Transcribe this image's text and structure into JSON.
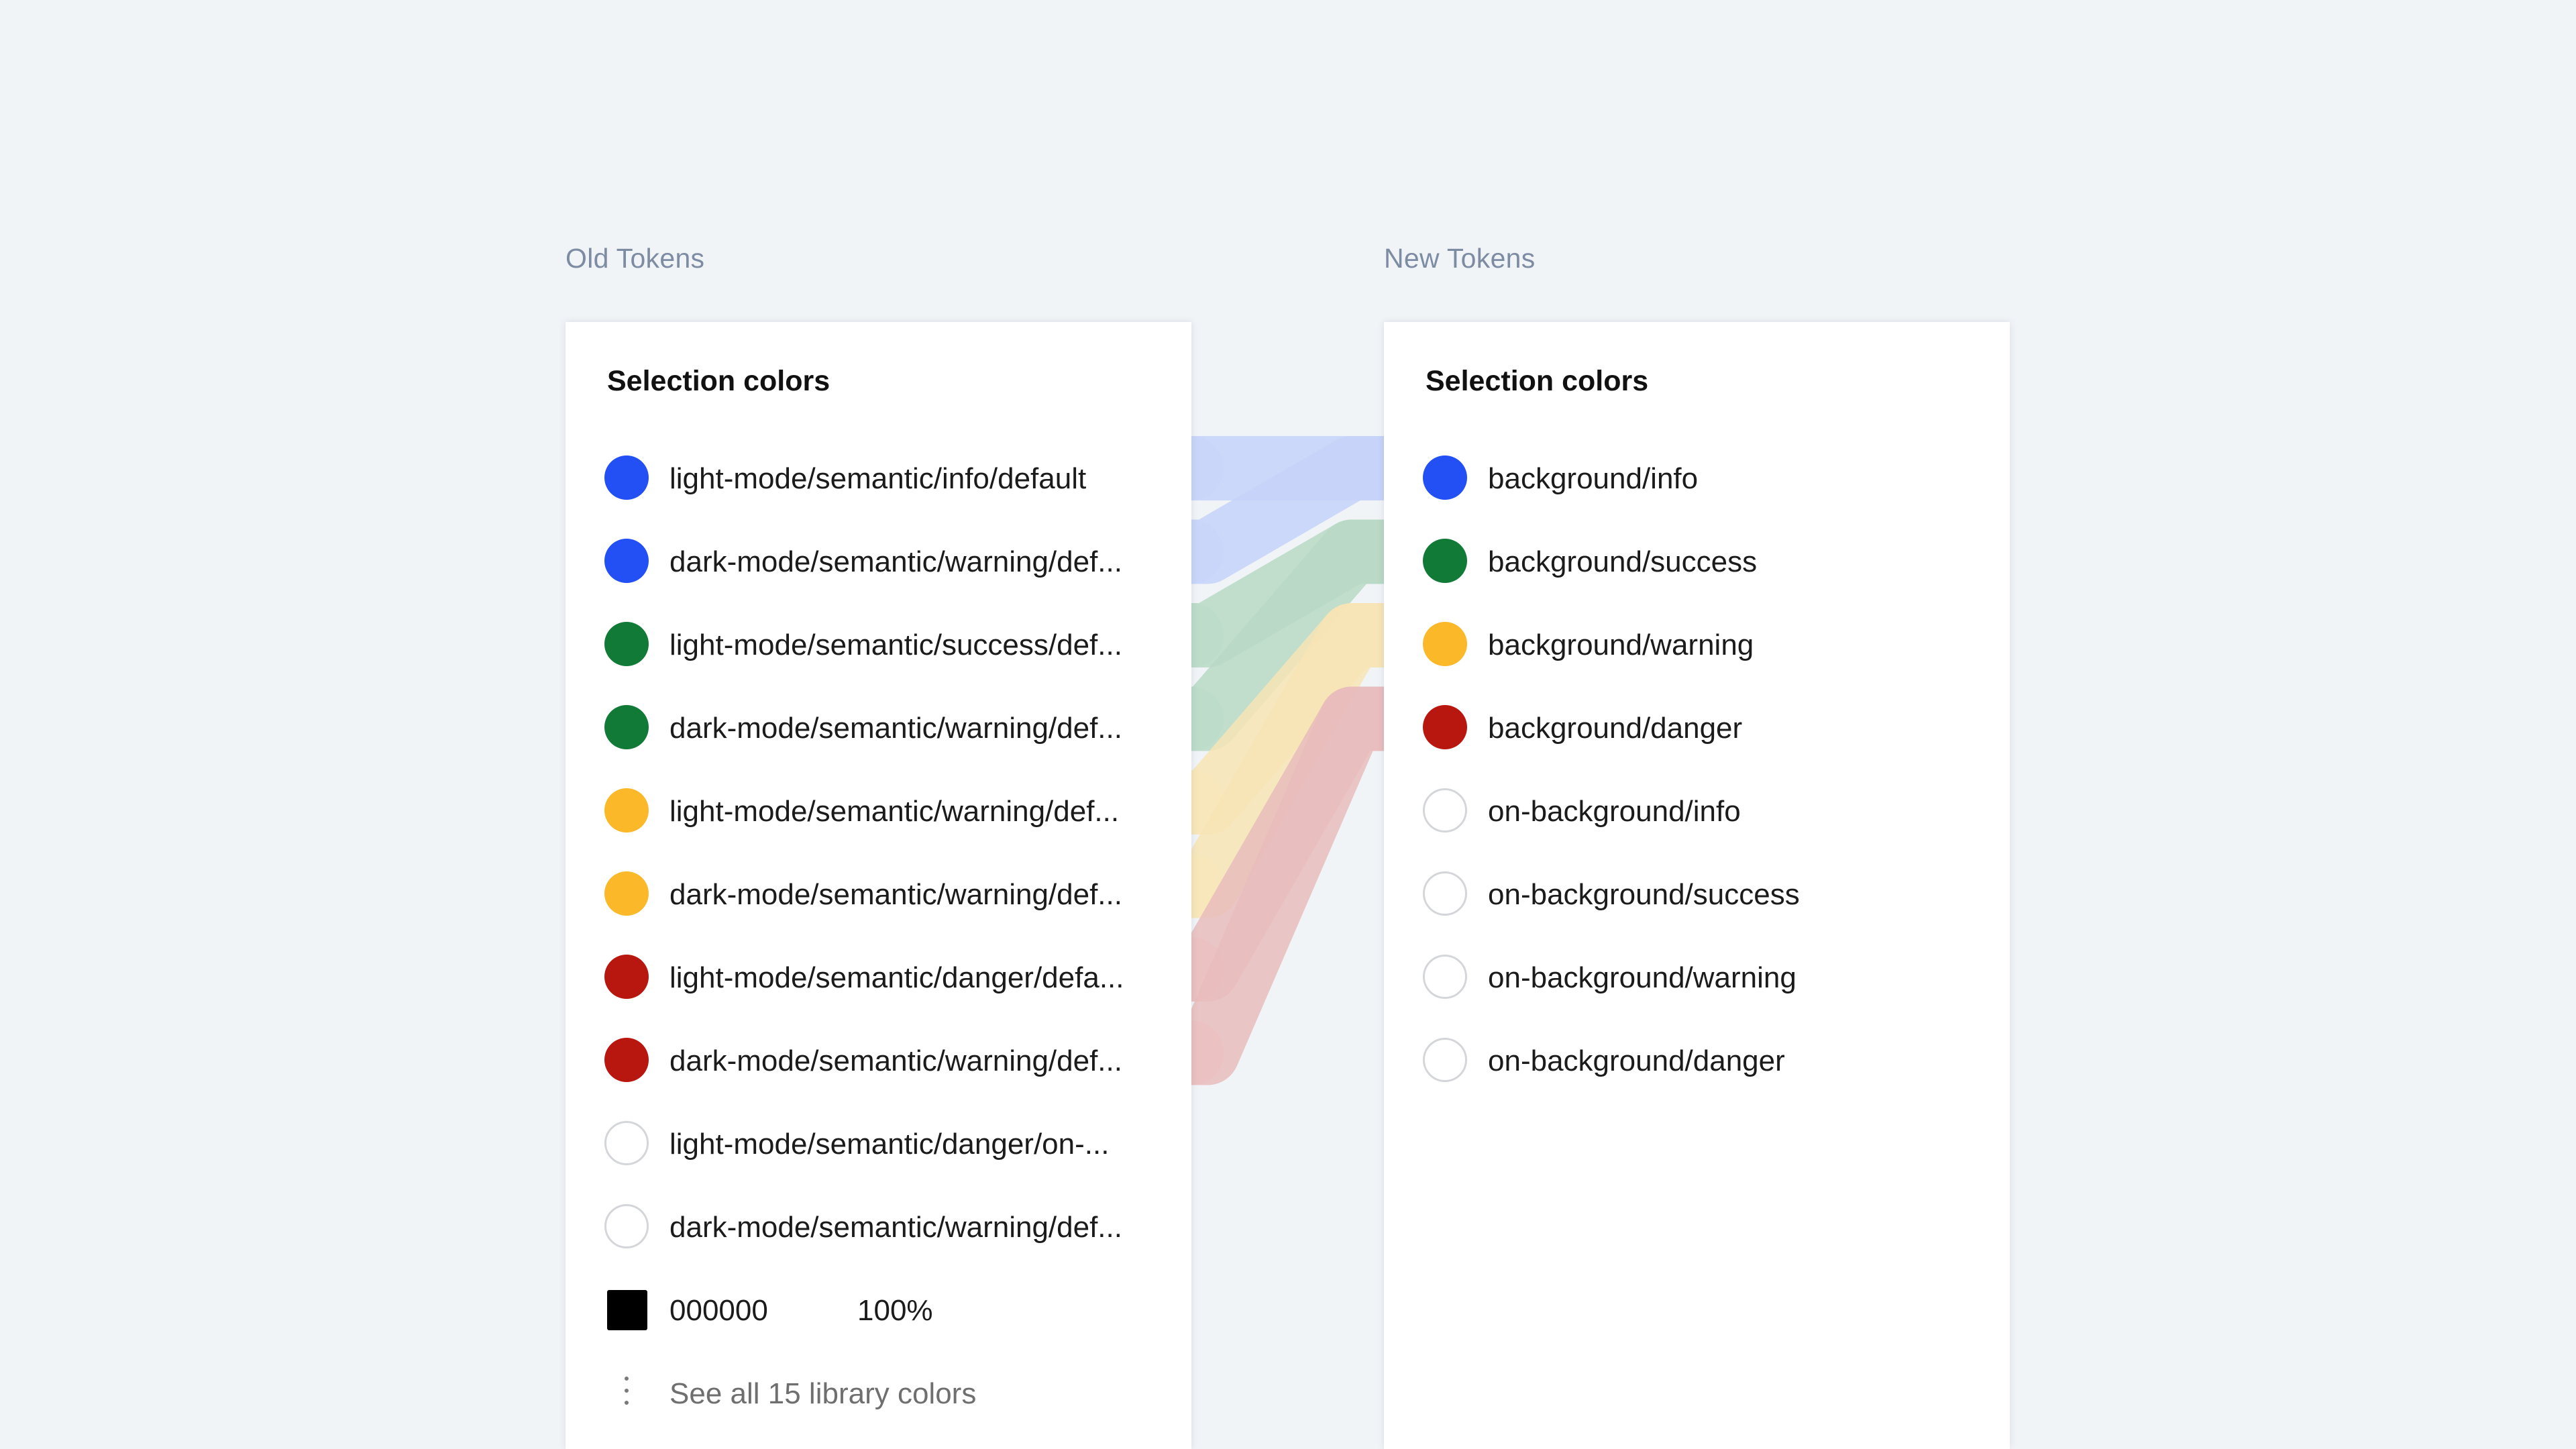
{
  "old_tokens": {
    "heading": "Old Tokens",
    "panel_title": "Selection colors",
    "rows": [
      {
        "label": "light-mode/semantic/info/default",
        "color": "#2350f5",
        "group": "info"
      },
      {
        "label": "dark-mode/semantic/warning/def...",
        "color": "#2350f5",
        "group": "info"
      },
      {
        "label": "light-mode/semantic/success/def...",
        "color": "#127a37",
        "group": "success"
      },
      {
        "label": "dark-mode/semantic/warning/def...",
        "color": "#127a37",
        "group": "success"
      },
      {
        "label": "light-mode/semantic/warning/def...",
        "color": "#fbb92a",
        "group": "warning"
      },
      {
        "label": "dark-mode/semantic/warning/def...",
        "color": "#fbb92a",
        "group": "warning"
      },
      {
        "label": "light-mode/semantic/danger/defa...",
        "color": "#b7170f",
        "group": "danger"
      },
      {
        "label": "dark-mode/semantic/warning/def...",
        "color": "#b7170f",
        "group": "danger"
      },
      {
        "label": "light-mode/semantic/danger/on-...",
        "color": "#ffffff",
        "group": "none"
      },
      {
        "label": "dark-mode/semantic/warning/def...",
        "color": "#ffffff",
        "group": "none"
      }
    ],
    "raw_color": {
      "hex": "000000",
      "opacity": "100%",
      "color": "#000000"
    },
    "see_all_label": "See all 15 library colors"
  },
  "new_tokens": {
    "heading": "New Tokens",
    "panel_title": "Selection colors",
    "rows": [
      {
        "label": "background/info",
        "color": "#2350f5",
        "group": "info"
      },
      {
        "label": "background/success",
        "color": "#127a37",
        "group": "success"
      },
      {
        "label": "background/warning",
        "color": "#fbb92a",
        "group": "warning"
      },
      {
        "label": "background/danger",
        "color": "#b7170f",
        "group": "danger"
      },
      {
        "label": "on-background/info",
        "color": "#ffffff",
        "group": "none"
      },
      {
        "label": "on-background/success",
        "color": "#ffffff",
        "group": "none"
      },
      {
        "label": "on-background/warning",
        "color": "#ffffff",
        "group": "none"
      },
      {
        "label": "on-background/danger",
        "color": "#ffffff",
        "group": "none"
      }
    ]
  },
  "mapping": [
    {
      "from_rows": [
        0,
        1
      ],
      "to_row": 0,
      "group": "info"
    },
    {
      "from_rows": [
        2,
        3
      ],
      "to_row": 1,
      "group": "success"
    },
    {
      "from_rows": [
        4,
        5
      ],
      "to_row": 2,
      "group": "warning"
    },
    {
      "from_rows": [
        6,
        7
      ],
      "to_row": 3,
      "group": "danger"
    }
  ],
  "highlight_colors": {
    "info": "#c6d2f9",
    "success": "#b9d9c6",
    "warning": "#f7e4b5",
    "danger": "#e9bcbc"
  },
  "highlight_colors_light": {
    "info": "#dfe6fc",
    "success": "#d9ebe0",
    "warning": "#fdf3dc",
    "danger": "#f5dcdc"
  }
}
